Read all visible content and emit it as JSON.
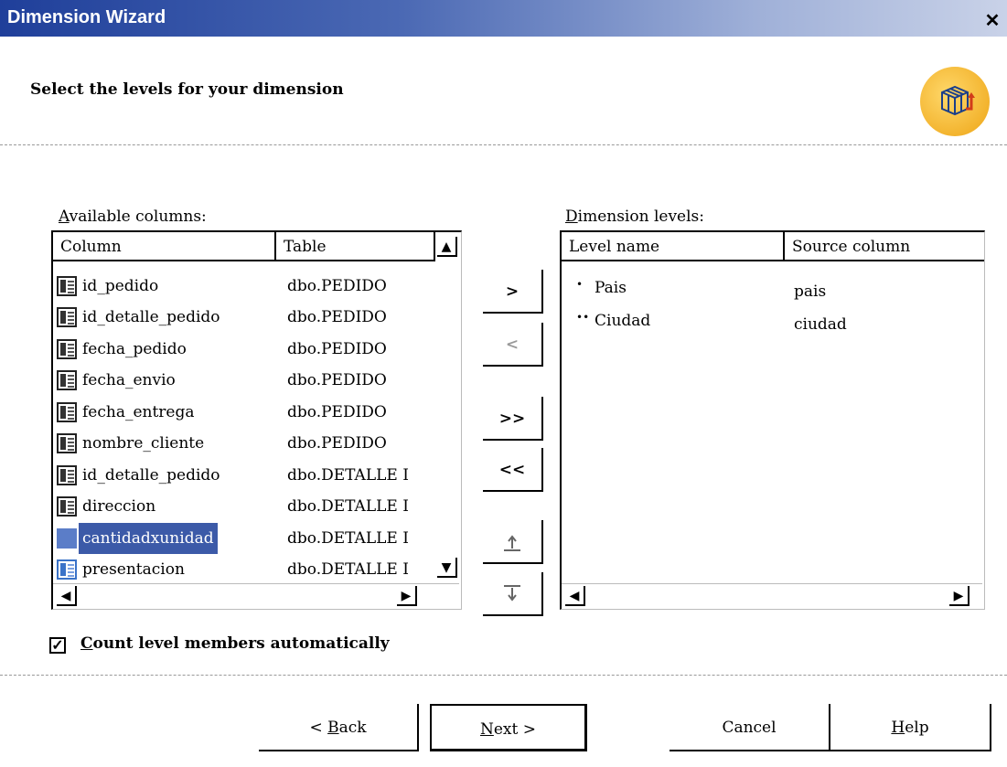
{
  "window": {
    "title": "Dimension Wizard",
    "close_glyph": "✕"
  },
  "header": {
    "title": "Select the levels for your dimension",
    "logo_icon": "cube-dimension-icon"
  },
  "available": {
    "label_first": "A",
    "label_rest": "vailable columns:",
    "headers": {
      "column": "Column",
      "table": "Table"
    },
    "rows": [
      {
        "column": "id_pedido",
        "table": "dbo.PEDIDO"
      },
      {
        "column": "id_detalle_pedido",
        "table": "dbo.PEDIDO"
      },
      {
        "column": "fecha_pedido",
        "table": "dbo.PEDIDO"
      },
      {
        "column": "fecha_envio",
        "table": "dbo.PEDIDO"
      },
      {
        "column": "fecha_entrega",
        "table": "dbo.PEDIDO"
      },
      {
        "column": "nombre_cliente",
        "table": "dbo.PEDIDO"
      },
      {
        "column": "id_detalle_pedido",
        "table": "dbo.DETALLE I"
      },
      {
        "column": "direccion",
        "table": "dbo.DETALLE I"
      },
      {
        "column": "cantidadxunidad",
        "table": "dbo.DETALLE I"
      },
      {
        "column": "presentacion",
        "table": "dbo.DETALLE I"
      }
    ],
    "selected_row": "cantidadxunidad"
  },
  "move_buttons": {
    "add": ">",
    "remove": "<",
    "add_all": ">>",
    "remove_all": "<<",
    "move_up": "move-up-icon",
    "move_down": "move-down-icon"
  },
  "levels": {
    "label_first": "D",
    "label_rest": "imension levels:",
    "headers": {
      "level": "Level name",
      "source": "Source column"
    },
    "rows": [
      {
        "bullet": "•",
        "level": "Pais",
        "source": "pais"
      },
      {
        "bullet": "••",
        "level": "Ciudad",
        "source": "ciudad"
      }
    ]
  },
  "options": {
    "count_checked": true,
    "check_glyph": "✓",
    "count_label_first": "C",
    "count_label_rest": "ount level members automatically"
  },
  "footer": {
    "back_pre": "< ",
    "back_first": "B",
    "back_rest": "ack",
    "next_first": "N",
    "next_rest": "ext >",
    "cancel": "Cancel",
    "help_first": "H",
    "help_rest": "elp"
  }
}
